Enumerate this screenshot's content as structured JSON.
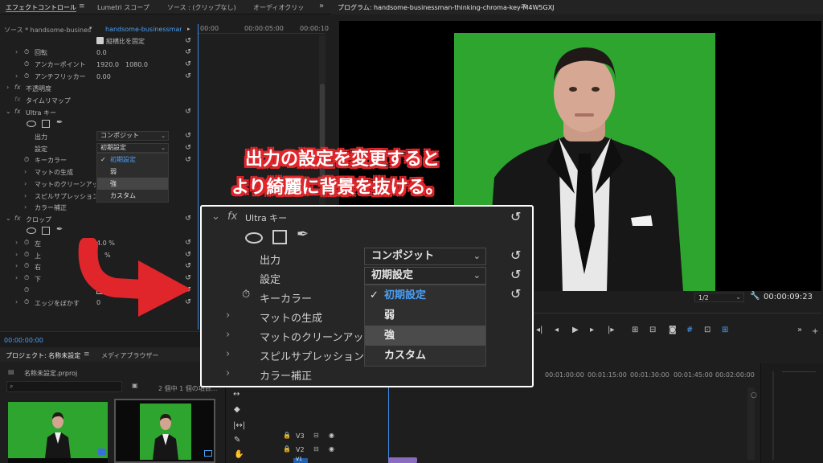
{
  "colors": {
    "accent": "#4a9ff5",
    "playhead": "#3b8bdc",
    "green_screen": "#2ea52f",
    "caption_outline": "#e0262b"
  },
  "effect_panel": {
    "tabs": [
      "エフェクトコントロール",
      "Lumetri スコープ",
      "ソース : (クリップなし)",
      "オーディオクリッ"
    ],
    "source_label": "ソース * handsome-businessm...",
    "clip_label": "handsome-businessman-th...",
    "time_start": "00:00",
    "time_mid": "00:00:05:00",
    "time_end": "00:00:10",
    "keep_aspect": "縦横比を固定",
    "rotation": "回転",
    "rotation_value": "0.0",
    "anchor": "アンカーポイント",
    "anchor_x": "1920.0",
    "anchor_y": "1080.0",
    "antiflicker": "アンチフリッカー",
    "antiflicker_value": "0.00",
    "opacity": "不透明度",
    "time_remap": "タイムリマップ",
    "ultra_key": "Ultra キー",
    "output": "出力",
    "output_value": "コンポジット",
    "setting": "設定",
    "setting_value": "初期設定",
    "key_color": "キーカラー",
    "matte_gen": "マットの生成",
    "matte_clean": "マットのクリーンアッ",
    "spill": "スピルサプレッション",
    "color_correct": "カラー補正",
    "crop": "クロップ",
    "left": "左",
    "left_value": "4.0 %",
    "top": "上",
    "top_value": "%",
    "right": "右",
    "bottom": "下",
    "zoom": "ズーム",
    "feather": "エッジをぼかす",
    "feather_value": "0",
    "timecode": "00:00:00:00",
    "menu": [
      "初期設定",
      "弱",
      "強",
      "カスタム"
    ]
  },
  "program": {
    "title": "プログラム: handsome-businessman-thinking-chroma-key-M4W5GXJ",
    "zoom_level": "1/2",
    "timecode": "00:00:09:23"
  },
  "project": {
    "tabs": [
      "プロジェクト: 名称未設定",
      "メディアブラウザー"
    ],
    "file": "名称未設定.prproj",
    "count": "2 個中 1 個の項目..."
  },
  "timeline": {
    "ruler": [
      "00:01:00:00",
      "00:01:15:00",
      "00:01:30:00",
      "00:01:45:00",
      "00:02:00:00"
    ],
    "tracks": [
      "V3",
      "V2",
      "V1"
    ]
  },
  "caption": {
    "line1": "出力の設定を変更すると",
    "line2": "より綺麗に背景を抜ける。"
  },
  "zoom_box": {
    "title": "Ultra キー",
    "fx": "fx",
    "output": "出力",
    "output_value": "コンポジット",
    "setting": "設定",
    "setting_value": "初期設定",
    "key_color": "キーカラー",
    "matte_gen": "マットの生成",
    "matte_clean": "マットのクリーンアップ",
    "spill": "スピルサプレッション",
    "color_correct": "カラー補正",
    "menu": [
      "初期設定",
      "弱",
      "強",
      "カスタム"
    ]
  }
}
